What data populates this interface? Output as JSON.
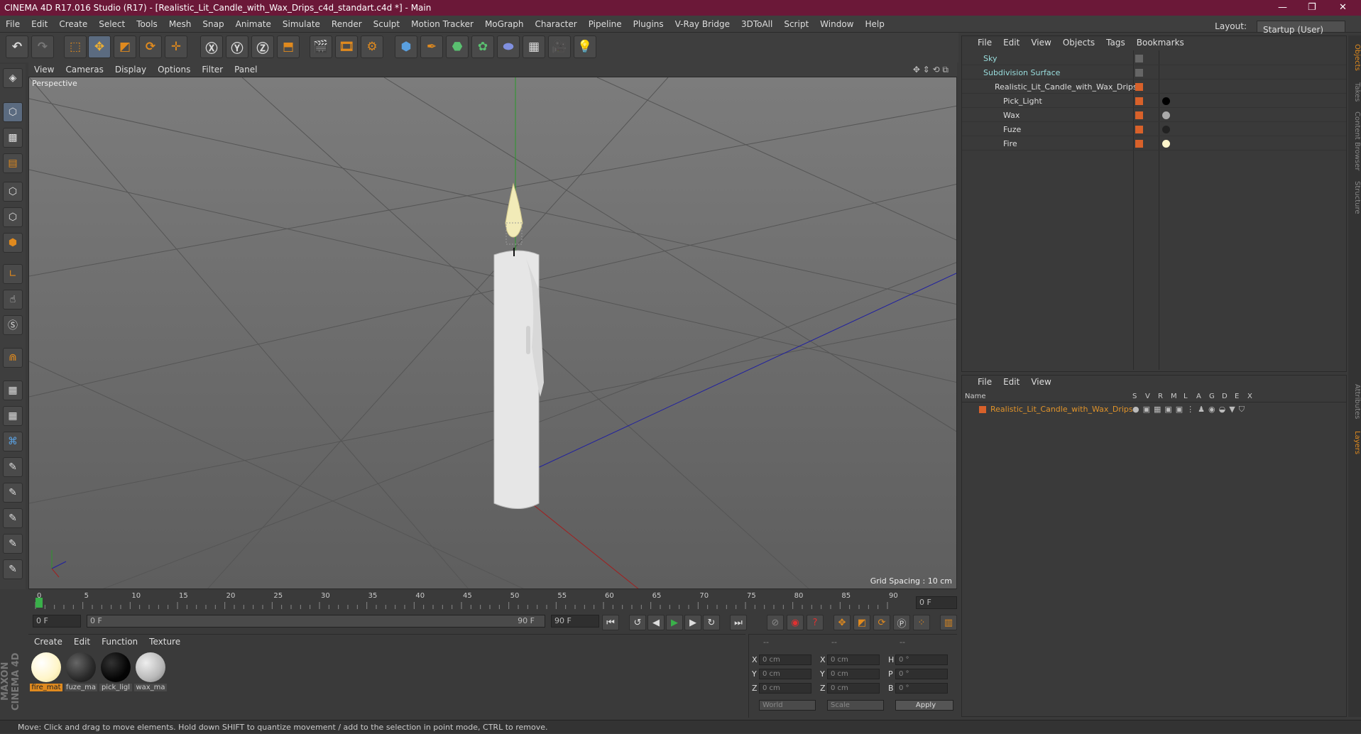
{
  "app": {
    "title": "CINEMA 4D R17.016 Studio (R17) - [Realistic_Lit_Candle_with_Wax_Drips_c4d_standart.c4d *] - Main"
  },
  "menu": [
    "File",
    "Edit",
    "Create",
    "Select",
    "Tools",
    "Mesh",
    "Snap",
    "Animate",
    "Simulate",
    "Render",
    "Sculpt",
    "Motion Tracker",
    "MoGraph",
    "Character",
    "Pipeline",
    "Plugins",
    "V-Ray Bridge",
    "3DToAll",
    "Script",
    "Window",
    "Help"
  ],
  "layout": {
    "label": "Layout:",
    "value": "Startup (User)"
  },
  "viewport": {
    "menu": [
      "View",
      "Cameras",
      "Display",
      "Options",
      "Filter",
      "Panel"
    ],
    "label": "Perspective",
    "grid": "Grid Spacing : 10 cm"
  },
  "timeline": {
    "ticks": [
      "0",
      "5",
      "10",
      "15",
      "20",
      "25",
      "30",
      "35",
      "40",
      "45",
      "50",
      "55",
      "60",
      "65",
      "70",
      "75",
      "80",
      "85",
      "90"
    ],
    "current": "0 F",
    "start": "0 F",
    "range_start": "0 F",
    "range_end": "90 F",
    "end": "90 F"
  },
  "materials": {
    "menu": [
      "Create",
      "Edit",
      "Function",
      "Texture"
    ],
    "items": [
      {
        "name": "fire_mat",
        "color": "#fffbe6"
      },
      {
        "name": "fuze_ma",
        "color": "#2a2a2a"
      },
      {
        "name": "pick_ligl",
        "color": "#050505"
      },
      {
        "name": "wax_ma",
        "color": "#b8b8b8"
      }
    ]
  },
  "coords": {
    "headers": [
      "--",
      "--",
      "--"
    ],
    "rows": [
      {
        "a": "X",
        "av": "0 cm",
        "b": "X",
        "bv": "0 cm",
        "c": "H",
        "cv": "0 °"
      },
      {
        "a": "Y",
        "av": "0 cm",
        "b": "Y",
        "bv": "0 cm",
        "c": "P",
        "cv": "0 °"
      },
      {
        "a": "Z",
        "av": "0 cm",
        "b": "Z",
        "bv": "0 cm",
        "c": "B",
        "cv": "0 °"
      }
    ],
    "world": "World",
    "scale": "Scale",
    "apply": "Apply"
  },
  "objects": {
    "menu": [
      "File",
      "Edit",
      "View",
      "Objects",
      "Tags",
      "Bookmarks"
    ],
    "items": [
      {
        "name": "Sky"
      },
      {
        "name": "Subdivision Surface"
      },
      {
        "name": "Realistic_Lit_Candle_with_Wax_Drips"
      },
      {
        "name": "Pick_Light"
      },
      {
        "name": "Wax"
      },
      {
        "name": "Fuze"
      },
      {
        "name": "Fire"
      }
    ]
  },
  "layers": {
    "menu": [
      "File",
      "Edit",
      "View"
    ],
    "header": "Name",
    "cols": [
      "S",
      "V",
      "R",
      "M",
      "L",
      "A",
      "G",
      "D",
      "E",
      "X"
    ],
    "item": "Realistic_Lit_Candle_with_Wax_Drips"
  },
  "side_tabs": [
    "Objects",
    "Takes",
    "Content Browser",
    "Structure",
    "Attributes",
    "Layers"
  ],
  "status": "Move: Click and drag to move elements. Hold down SHIFT to quantize movement / add to the selection in point mode, CTRL to remove.",
  "brand": "MAXON CINEMA 4D"
}
